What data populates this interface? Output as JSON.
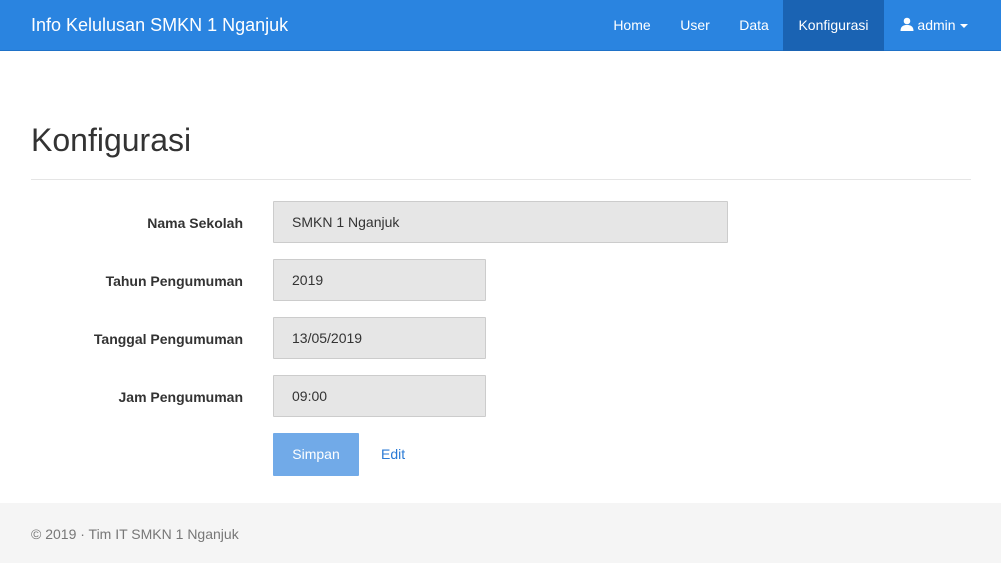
{
  "navbar": {
    "brand": "Info Kelulusan SMKN 1 Nganjuk",
    "items": [
      {
        "label": "Home"
      },
      {
        "label": "User"
      },
      {
        "label": "Data"
      },
      {
        "label": "Konfigurasi",
        "active": true
      }
    ],
    "user_label": "admin",
    "user_icon": "user-icon",
    "bg_color": "#2a84e0",
    "active_color": "#1a63b3"
  },
  "page": {
    "title": "Konfigurasi"
  },
  "form": {
    "fields": [
      {
        "label": "Nama Sekolah",
        "value": "SMKN 1 Nganjuk"
      },
      {
        "label": "Tahun Pengumuman",
        "value": "2019"
      },
      {
        "label": "Tanggal Pengumuman",
        "value": "13/05/2019"
      },
      {
        "label": "Jam Pengumuman",
        "value": "09:00"
      }
    ],
    "save_label": "Simpan",
    "edit_label": "Edit"
  },
  "footer": {
    "text": "© 2019 · Tim IT SMKN 1 Nganjuk"
  }
}
